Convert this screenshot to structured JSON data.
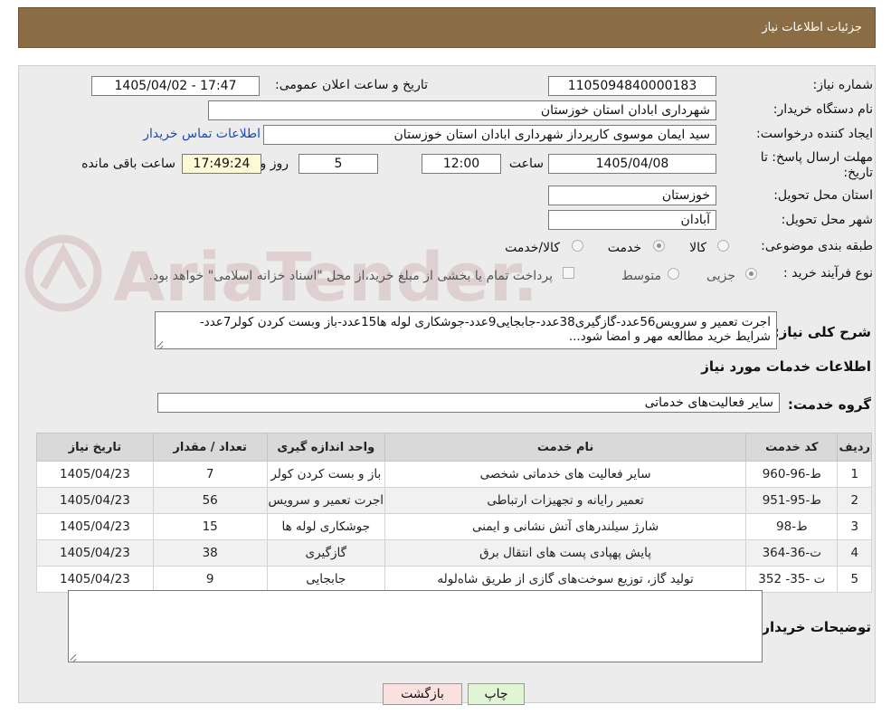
{
  "header": {
    "title": "جزئیات اطلاعات نیاز"
  },
  "form": {
    "need_number_label": "شماره نیاز:",
    "need_number": "1105094840000183",
    "announce_label": "تاریخ و ساعت اعلان عمومی:",
    "announce_value": "1405/04/02 - 17:47",
    "buyer_org_label": "نام دستگاه خریدار:",
    "buyer_org": "شهرداری ابادان استان خوزستان",
    "creator_label": "ایجاد کننده درخواست:",
    "creator": "سید ایمان موسوی کارپرداز شهرداری ابادان استان خوزستان",
    "contact_link": "اطلاعات تماس خریدار",
    "deadline_label_1": "مهلت ارسال پاسخ: تا",
    "deadline_label_2": "تاریخ:",
    "deadline_date": "1405/04/08",
    "time_label": "ساعت",
    "deadline_time": "12:00",
    "days_value": "5",
    "days_label": "روز و",
    "remaining_time": "17:49:24",
    "remaining_label": "ساعت باقی مانده",
    "province_label": "استان محل تحویل:",
    "province": "خوزستان",
    "city_label": "شهر محل تحویل:",
    "city": "آبادان",
    "category_label": "طبقه بندی موضوعی:",
    "category_options": [
      "کالا",
      "خدمت",
      "کالا/خدمت"
    ],
    "category_selected": "خدمت",
    "process_label": "نوع فرآیند خرید :",
    "process_options": [
      "جزیی",
      "متوسط"
    ],
    "process_selected": "جزیی",
    "payment_note": "پرداخت تمام یا بخشی از مبلغ خرید،از محل \"اسناد خزانه اسلامی\" خواهد بود.",
    "summary_label": "شرح کلی نیاز:",
    "summary_text": "اجرت تعمیر و سرویس56عدد-گازگیری38عدد-جابجایی9عدد-جوشکاری لوله ها15عدد-باز وبست کردن کولر7عدد- شرایط خرید مطالعه مهر و امضا شود...",
    "services_section": "اطلاعات خدمات مورد نیاز",
    "service_group_label": "گروه خدمت:",
    "service_group": "سایر فعالیت‌های خدماتی",
    "buyer_notes_label": "توضیحات خریدار:",
    "buyer_notes": ""
  },
  "table": {
    "headers": [
      "ردیف",
      "کد خدمت",
      "نام خدمت",
      "واحد اندازه گیری",
      "تعداد / مقدار",
      "تاریخ نیاز"
    ],
    "rows": [
      [
        "1",
        "ط-96-960",
        "سایر فعالیت های خدماتی شخصی",
        "باز و بست کردن کولر",
        "7",
        "1405/04/23"
      ],
      [
        "2",
        "ط-95-951",
        "تعمیر رایانه و تجهیزات ارتباطی",
        "اجرت تعمیر و سرویس",
        "56",
        "1405/04/23"
      ],
      [
        "3",
        "ط-98",
        "شارژ سیلندرهای آتش نشانی و ایمنی",
        "جوشکاری لوله ها",
        "15",
        "1405/04/23"
      ],
      [
        "4",
        "ت-36-364",
        "پایش پهپادی پست های انتقال برق",
        "گازگیری",
        "38",
        "1405/04/23"
      ],
      [
        "5",
        "ت -35- 352",
        "تولید گاز، توزیع سوخت‌های گازی از طریق شاه‌لوله",
        "جابجایی",
        "9",
        "1405/04/23"
      ]
    ]
  },
  "buttons": {
    "print": "چاپ",
    "back": "بازگشت"
  },
  "watermark": {
    "text": "AriaTender.neT"
  },
  "colors": {
    "header_bg": "#8a6d45",
    "panel_bg": "#ececec",
    "remaining_bg": "#fcf9d6",
    "print_btn": "#dff5d3",
    "back_btn": "#fbe0e0"
  }
}
